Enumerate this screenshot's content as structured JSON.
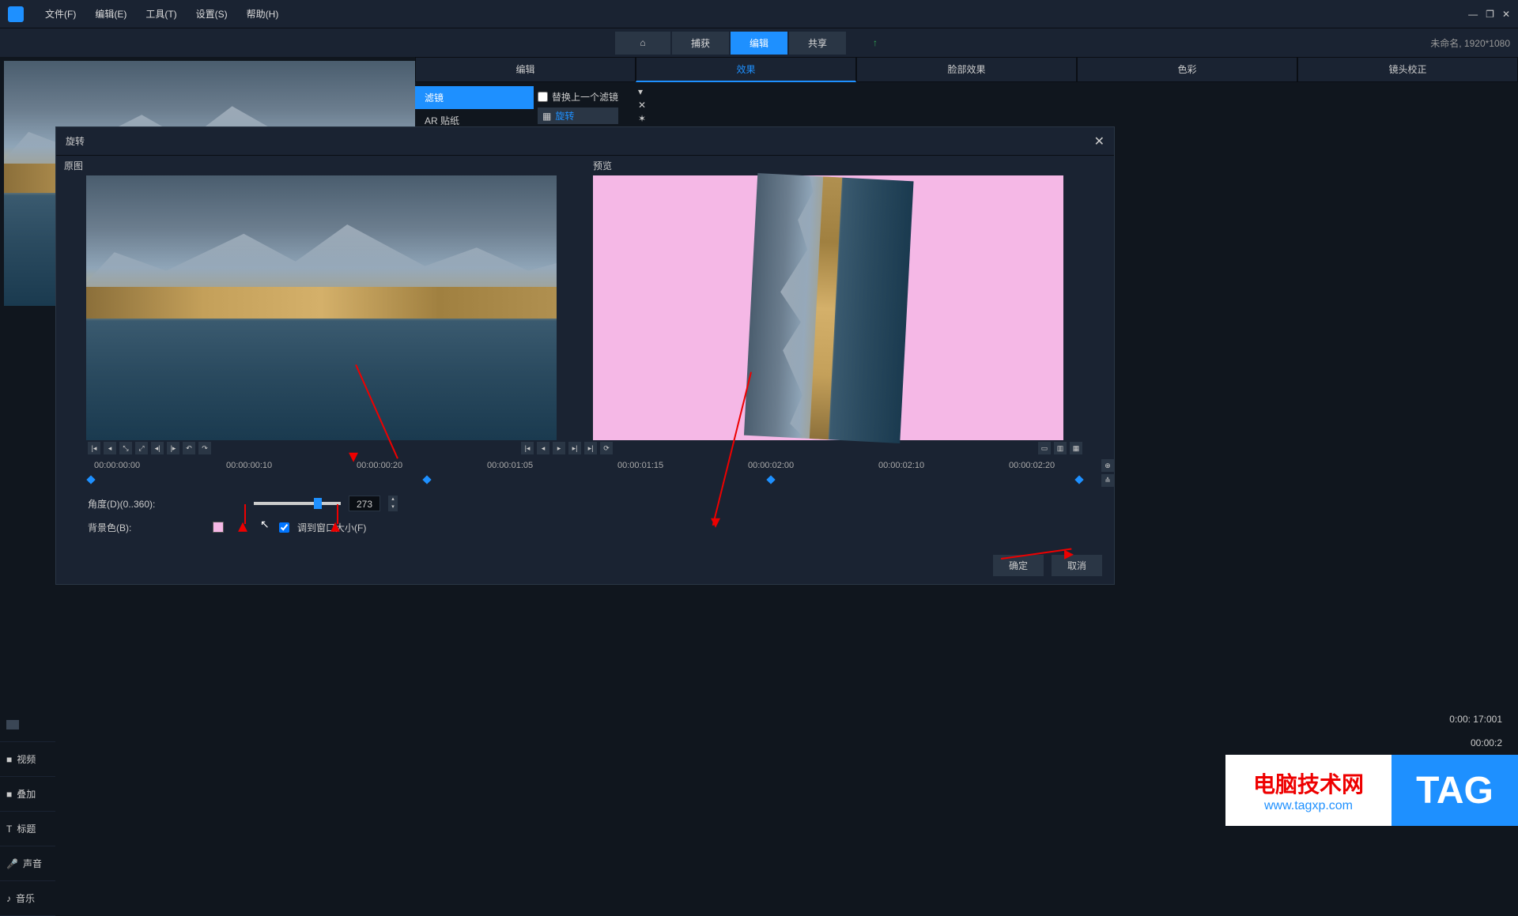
{
  "menu": {
    "file": "文件(F)",
    "edit": "编辑(E)",
    "tools": "工具(T)",
    "settings": "设置(S)",
    "help": "帮助(H)"
  },
  "nav": {
    "capture": "捕获",
    "edit": "编辑",
    "share": "共享"
  },
  "project_info": "未命名, 1920*1080",
  "subtabs": {
    "edit": "编辑",
    "effect": "效果",
    "face": "脸部效果",
    "color": "色彩",
    "lens": "镜头校正"
  },
  "filters": {
    "filter": "滤镜",
    "ar": "AR 贴纸"
  },
  "filter_opts": {
    "replace": "替换上一个滤镜",
    "rotate": "旋转"
  },
  "modal": {
    "title": "旋转",
    "original": "原图",
    "preview": "预览",
    "angle_label": "角度(D)(0..360):",
    "angle_value": "273",
    "bg_label": "背景色(B):",
    "bg_color": "#f5b8e6",
    "fit_window": "调到窗口大小(F)",
    "ok": "确定",
    "cancel": "取消"
  },
  "timecodes": [
    "00:00:00:00",
    "00:00:00:10",
    "00:00:00:20",
    "00:00:01:05",
    "00:00:01:15",
    "00:00:02:00",
    "00:00:02:10",
    "00:00:02:20"
  ],
  "tl_tabs": {
    "video": "视频",
    "overlay": "叠加",
    "title": "标题",
    "voice": "声音",
    "music": "音乐"
  },
  "tc_display": "0:00: 17:001",
  "tc_end": "00:00:2",
  "watermark": {
    "title": "电脑技术网",
    "url": "www.tagxp.com",
    "tag": "TAG"
  }
}
